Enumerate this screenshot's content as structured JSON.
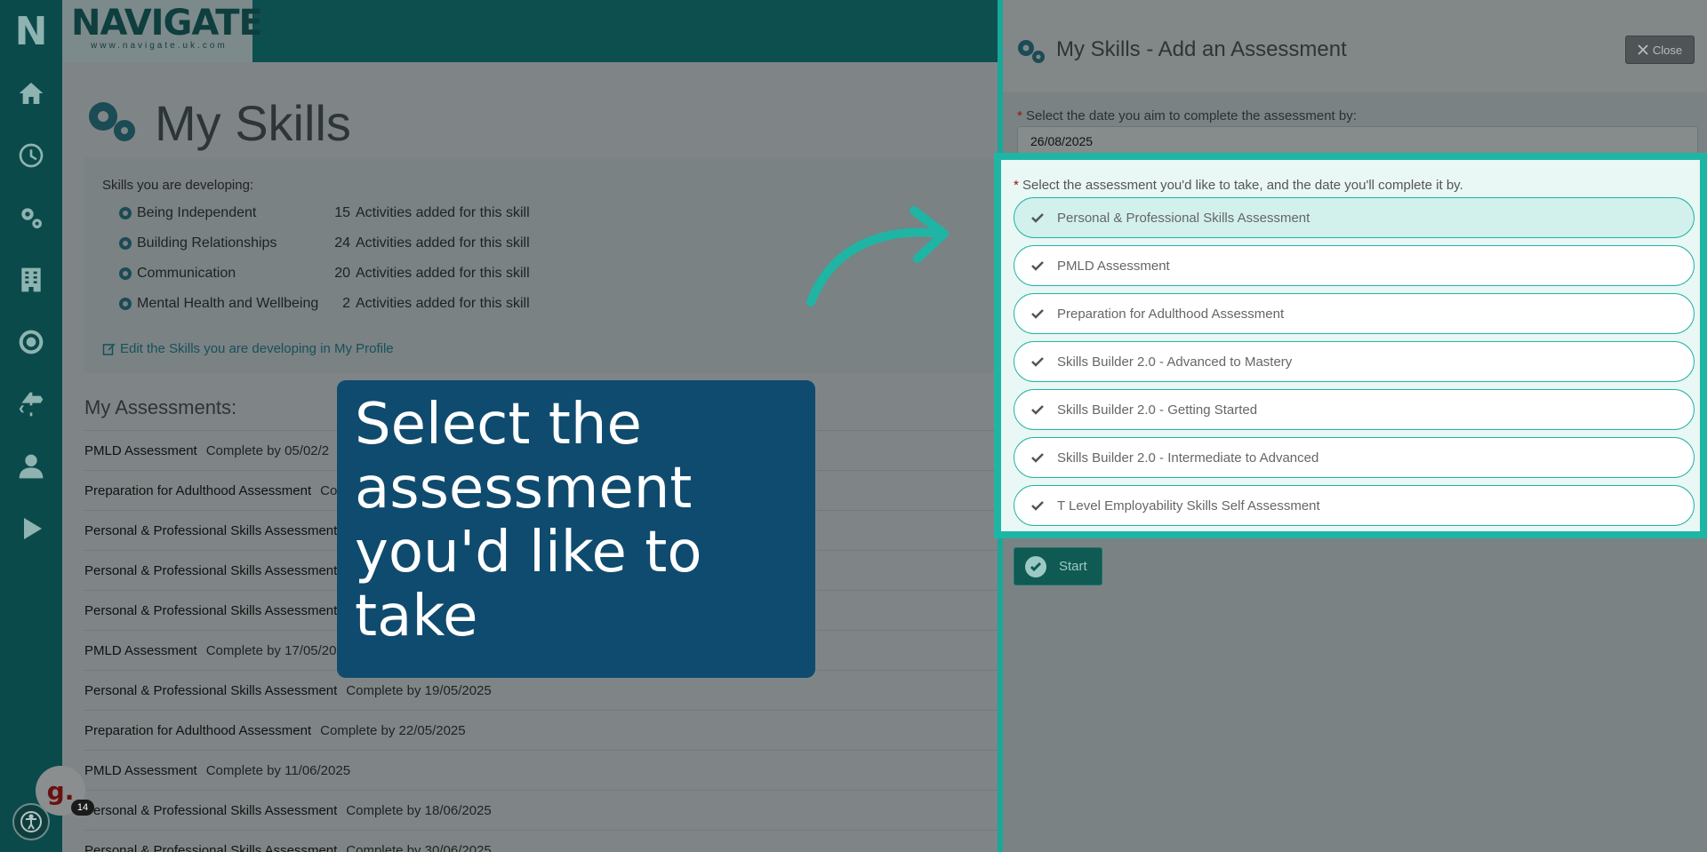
{
  "sidebar": {
    "logo": "N",
    "icons": [
      "home-icon",
      "clock-icon",
      "gears-icon",
      "building-icon",
      "target-icon",
      "signpost-icon",
      "person-icon",
      "play-icon"
    ]
  },
  "brand": {
    "name": "NAVIGATE",
    "url": "www.navigate.uk.com"
  },
  "page": {
    "title": "My Skills",
    "skills_heading": "Skills you are developing:",
    "skills": [
      {
        "name": "Being Independent",
        "count": "15",
        "suffix": "Activities added for this skill"
      },
      {
        "name": "Building Relationships",
        "count": "24",
        "suffix": "Activities added for this skill"
      },
      {
        "name": "Communication",
        "count": "20",
        "suffix": "Activities added for this skill"
      },
      {
        "name": "Mental Health and Wellbeing",
        "count": "2",
        "suffix": "Activities added for this skill"
      }
    ],
    "edit_link": "Edit the Skills you are developing in My Profile",
    "assessments_heading": "My Assessments:",
    "assessments": [
      {
        "name": "PMLD Assessment",
        "due": "Complete by 05/02/2"
      },
      {
        "name": "Preparation for Adulthood Assessment",
        "due": "Co"
      },
      {
        "name": "Personal & Professional Skills Assessment",
        "due": ""
      },
      {
        "name": "Personal & Professional Skills Assessment",
        "due": ""
      },
      {
        "name": "Personal & Professional Skills Assessment",
        "due": ""
      },
      {
        "name": "PMLD Assessment",
        "due": "Complete by 17/05/20"
      },
      {
        "name": "Personal & Professional Skills Assessment",
        "due": "Complete by 19/05/2025"
      },
      {
        "name": "Preparation for Adulthood Assessment",
        "due": "Complete by 22/05/2025"
      },
      {
        "name": "PMLD Assessment",
        "due": "Complete by 11/06/2025"
      },
      {
        "name": "Personal & Professional Skills Assessment",
        "due": "Complete by 18/06/2025"
      },
      {
        "name": "Personal & Professional Skills Assessment",
        "due": "Complete by 30/06/2025"
      }
    ]
  },
  "callout": {
    "text": "Select the assessment you'd like to take"
  },
  "panel": {
    "title": "My Skills - Add an Assessment",
    "close_label": "Close",
    "date_label": "Select the date you aim to complete the assessment by:",
    "date_value": "26/08/2025",
    "assessment_label": "Select the assessment you'd like to take, and the date you'll complete it by.",
    "options": [
      "Personal & Professional Skills Assessment",
      "PMLD Assessment",
      "Preparation for Adulthood Assessment",
      "Skills Builder 2.0 - Advanced to Mastery",
      "Skills Builder 2.0 - Getting Started",
      "Skills Builder 2.0 - Intermediate to Advanced",
      "T Level Employability Skills Self Assessment"
    ],
    "start_label": "Start",
    "required_mark": "*"
  },
  "widgets": {
    "g_label": "g.",
    "g_count": "14"
  },
  "colors": {
    "accent": "#1fb5a5",
    "callout": "#0f4b6e",
    "sidebar": "#0b4a4a"
  }
}
